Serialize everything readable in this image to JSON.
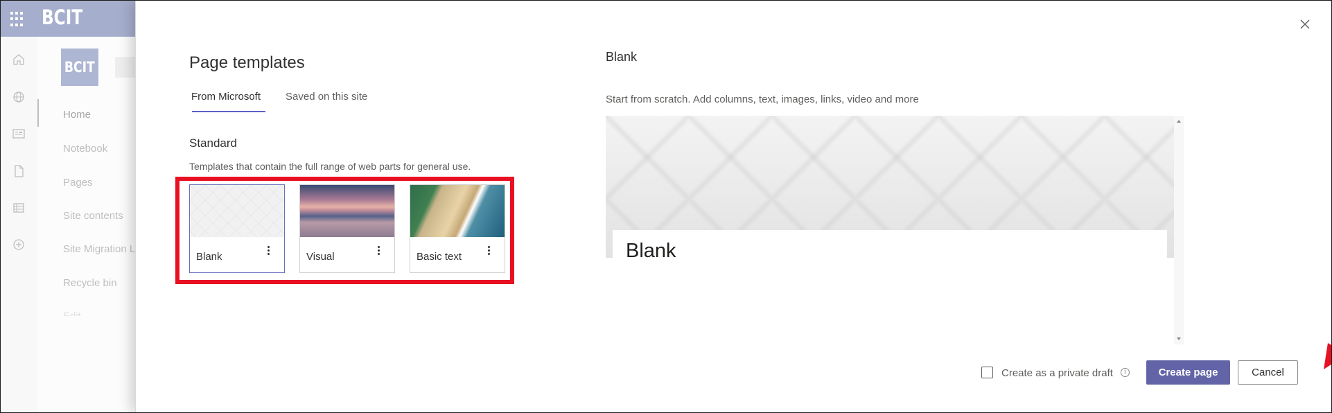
{
  "app": {
    "title": "BCIT",
    "site_logo_text": "BCIT",
    "accent_color": "#5c6ea5",
    "rail_icons": [
      "home-icon",
      "globe-icon",
      "news-icon",
      "document-icon",
      "list-icon",
      "add-icon"
    ],
    "nav": [
      "Home",
      "Notebook",
      "Pages",
      "Site contents",
      "Site Migration L",
      "Recycle bin",
      "Edit"
    ]
  },
  "dialog": {
    "title": "Page templates",
    "tabs": [
      "From Microsoft",
      "Saved on this site"
    ],
    "section_title": "Standard",
    "section_desc": "Templates that contain the full range of web parts for general use.",
    "templates": [
      {
        "label": "Blank",
        "selected": true
      },
      {
        "label": "Visual",
        "selected": false
      },
      {
        "label": "Basic text",
        "selected": false
      }
    ],
    "preview": {
      "title": "Blank",
      "description": "Start from scratch. Add columns, text, images, links, video and more",
      "heading": "Blank"
    },
    "private_draft_label": "Create as a private draft",
    "create_button": "Create page",
    "cancel_button": "Cancel",
    "primary_color": "#6264a7"
  },
  "annotations": {
    "highlight_color": "#e81123"
  }
}
